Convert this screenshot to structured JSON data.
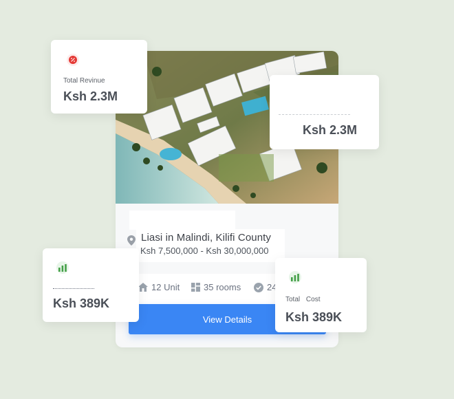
{
  "property": {
    "location": "Liasi in Malindi, Kilifi County",
    "price_range": "Ksh 7,500,000 - Ksh 30,000,000",
    "units": "12 Unit",
    "rooms": "35 rooms",
    "third_stat": "24",
    "cta_label": "View Details"
  },
  "revenue_card": {
    "label": "Total Revinue",
    "value": "Ksh 2.3M",
    "icon": "percent-icon",
    "accent": "#e53935"
  },
  "top_right_card": {
    "value": "Ksh 2.3M"
  },
  "bottom_left_card": {
    "value": "Ksh 389K",
    "icon": "bar-chart-icon",
    "accent": "#43a047"
  },
  "cost_card": {
    "label_1": "Total",
    "label_2": "Cost",
    "value": "Ksh 389K",
    "icon": "bar-chart-icon",
    "accent": "#43a047"
  },
  "colors": {
    "background": "#e4ebe0",
    "button": "#3a86f4"
  }
}
